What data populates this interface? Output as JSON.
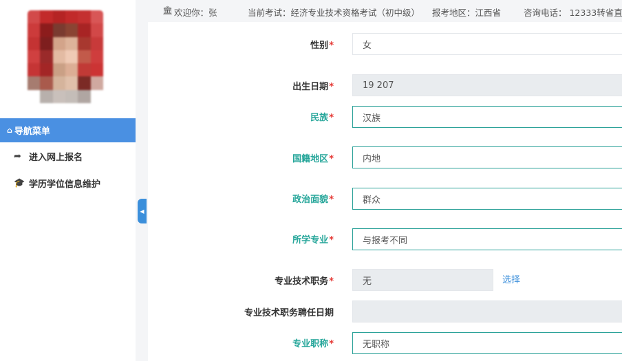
{
  "topbar": {
    "bank_icon": "bank-icon",
    "welcome": "欢迎你：张",
    "exam": "当前考试：经济专业技术资格考试（初中级）",
    "region": "报考地区：江西省",
    "phone": "咨询电话： 12333转省直"
  },
  "sidebar": {
    "nav_header": "导航菜单",
    "items": [
      {
        "label": "进入网上报名",
        "icon": "share-arrow-icon"
      },
      {
        "label": "学历学位信息维护",
        "icon": "graduation-cap-icon"
      }
    ]
  },
  "colors": {
    "nav_active": "#4a90e2",
    "green_label": "#26a69a",
    "green_border": "#2aa198",
    "required": "#e53935",
    "link": "#3b8fdb"
  },
  "form": {
    "gender": {
      "label": "性别",
      "value": "女"
    },
    "birth_date": {
      "label": "出生日期",
      "value": "19    207"
    },
    "ethnicity": {
      "label": "民族",
      "value": "汉族"
    },
    "nationality": {
      "label": "国籍地区",
      "value": "内地"
    },
    "political": {
      "label": "政治面貌",
      "value": "群众"
    },
    "major": {
      "label": "所学专业",
      "value": "与报考不同"
    },
    "tech_title": {
      "label": "专业技术职务",
      "value": "无",
      "action": "选择"
    },
    "tech_title_date": {
      "label": "专业技术职务聘任日期",
      "value": ""
    },
    "prof_title": {
      "label": "专业职称",
      "value": "无职称"
    },
    "required_mark": "*"
  }
}
